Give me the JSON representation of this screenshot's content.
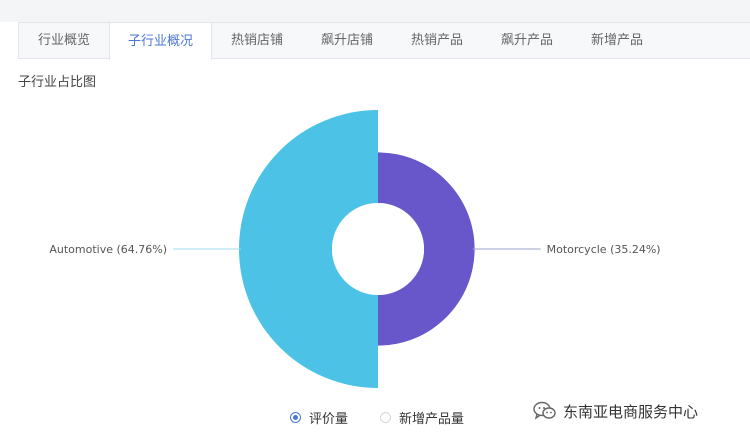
{
  "tabs": [
    {
      "label": "行业概览",
      "active": false
    },
    {
      "label": "子行业概况",
      "active": true
    },
    {
      "label": "热销店铺",
      "active": false
    },
    {
      "label": "飙升店铺",
      "active": false
    },
    {
      "label": "热销产品",
      "active": false
    },
    {
      "label": "飙升产品",
      "active": false
    },
    {
      "label": "新增产品",
      "active": false
    }
  ],
  "section_title": "子行业占比图",
  "chart_data": {
    "type": "pie",
    "variant": "rose-donut",
    "title": "",
    "slices": [
      {
        "name": "Automotive",
        "percent": 64.76,
        "label": "Automotive (64.76%)",
        "color": "#4cc3e6"
      },
      {
        "name": "Motorcycle",
        "percent": 35.24,
        "label": "Motorcycle (35.24%)",
        "color": "#6757ca"
      }
    ],
    "label_line_color": "#c8d8f0"
  },
  "legend": {
    "items": [
      {
        "label": "评价量",
        "selected": true
      },
      {
        "label": "新增产品量",
        "selected": false
      }
    ]
  },
  "watermark": {
    "text": "东南亚电商服务中心",
    "icon": "wechat-icon"
  },
  "colors": {
    "accent": "#4a78d4",
    "automotive": "#4cc3e6",
    "motorcycle": "#6757ca"
  }
}
